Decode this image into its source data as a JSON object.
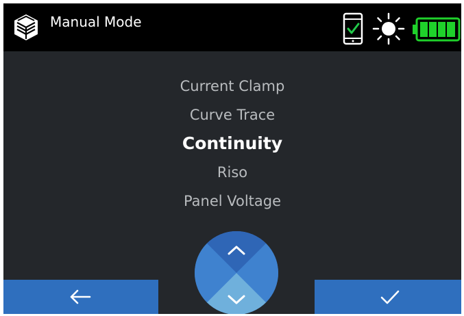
{
  "header": {
    "title": "Manual Mode",
    "logo_icon": "cube-logo-icon",
    "status_icons": [
      "phone-connected-icon",
      "brightness-icon",
      "battery-full-icon"
    ],
    "battery_level": 1.0
  },
  "menu": {
    "items": [
      {
        "label": "Current Clamp"
      },
      {
        "label": "Curve Trace"
      },
      {
        "label": "Continuity"
      },
      {
        "label": "Riso"
      },
      {
        "label": "Panel Voltage"
      }
    ],
    "selected_index": 2
  },
  "footer": {
    "back_icon": "arrow-left-icon",
    "confirm_icon": "checkmark-icon",
    "scroll_up_icon": "chevron-up-icon",
    "scroll_down_icon": "chevron-down-icon"
  },
  "colors": {
    "background": "#24272b",
    "header": "#000000",
    "button_blue": "#2f6fbe",
    "dial_blue": "#3a78c9",
    "dial_light": "#6fb0dc",
    "battery_green": "#1fd12b",
    "check_green": "#22c94a"
  }
}
